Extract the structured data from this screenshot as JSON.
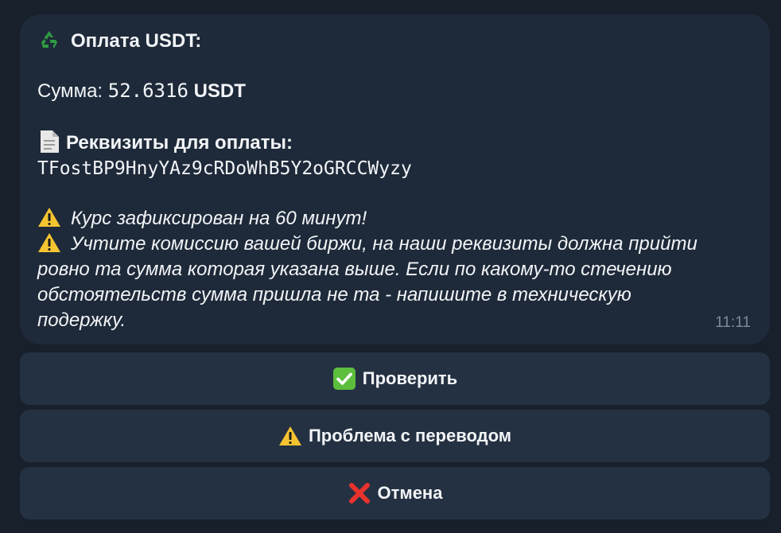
{
  "message": {
    "title": "Оплата USDT:",
    "amount_label": "Сумма:",
    "amount_value": "52.6316",
    "amount_currency": "USDT",
    "requisites_label": "Реквизиты для оплаты:",
    "wallet_address": "TFostBP9HnyYAz9cRDoWhB5Y2oGRCCWyzy",
    "warning_rate": "Курс зафиксирован на 60 минут!",
    "warning_fee_line1": "Учтите комиссию вашей биржи, на наши реквизиты должна прийти",
    "warning_fee_line2": "ровно та сумма которая указана выше. Если по какому-то стечению",
    "warning_fee_line3": "обстоятельств сумма пришла не та - напишите в техническую",
    "warning_fee_line4": "подержку.",
    "time": "11:11"
  },
  "buttons": {
    "check_label": "Проверить",
    "problem_label": "Проблема с переводом",
    "cancel_label": "Отмена"
  },
  "icons": {
    "title": "recycle-icon",
    "requisites": "document-icon",
    "warning": "warning-icon",
    "check": "check-mark-icon",
    "cancel": "cross-mark-icon"
  },
  "colors": {
    "background": "#17202b",
    "bubble": "#1e2a39",
    "button": "#243142",
    "text": "#f2f4f7",
    "time": "#7d8a99",
    "warning": "#f4c430",
    "check": "#5dbe3e",
    "cancel": "#e8322d",
    "recycle": "#2e9b42"
  }
}
